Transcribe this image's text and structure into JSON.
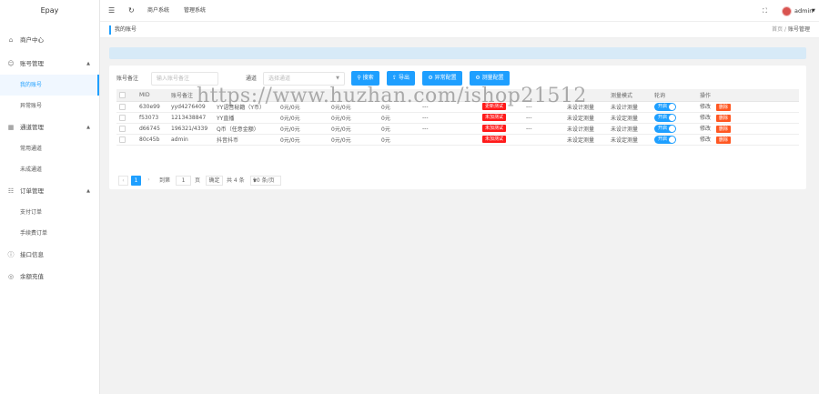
{
  "app": {
    "brand": "Epay"
  },
  "topbar": {
    "links": [
      "商户系统",
      "管理系统"
    ],
    "user": "admin"
  },
  "sidebar": {
    "items": [
      {
        "label": "商户中心",
        "icon": "home-icon"
      },
      {
        "label": "账号管理",
        "icon": "user-icon",
        "expanded": true,
        "children": [
          "我的账号",
          "异常账号"
        ]
      },
      {
        "label": "通道管理",
        "icon": "grid-icon",
        "expanded": true,
        "children": [
          "常用通道",
          "未成通道"
        ]
      },
      {
        "label": "订单管理",
        "icon": "order-icon",
        "expanded": true,
        "children": [
          "支付订单",
          "手续费订单"
        ]
      },
      {
        "label": "接口信息",
        "icon": "info-icon"
      },
      {
        "label": "余额充值",
        "icon": "wallet-icon"
      }
    ],
    "active": "我的账号"
  },
  "tabs": {
    "current": "我的账号"
  },
  "breadcrumb": {
    "home": "首页",
    "separator": "/",
    "current": "账号管理"
  },
  "filters": {
    "account_label": "账号备注",
    "account_placeholder": "输入账号备注",
    "channel_label": "通道",
    "channel_placeholder": "选择通道"
  },
  "buttons": {
    "search": "搜索",
    "export": "导出",
    "async_config": "异常配置",
    "batch_config": "测量配置"
  },
  "table": {
    "headers": [
      "",
      "MID",
      "账号备注",
      "",
      "",
      "",
      "",
      "",
      "",
      "",
      "",
      "测量模式",
      "轮询",
      "操作"
    ],
    "rows": [
      {
        "mid": "630e99",
        "account": "yyd4276409",
        "channel": "YY语音秘籍（Y币）",
        "m1": "0元/0元",
        "m2": "0元/0元",
        "m3": "0元",
        "m4": "---",
        "status": "更新测试",
        "m5": "---",
        "mode1": "未设计测量",
        "mode2": "未设计测量",
        "poll": "开启",
        "edit": "修改",
        "del": "删除"
      },
      {
        "mid": "f53073",
        "account": "1213438847",
        "channel": "YY直播",
        "m1": "0元/0元",
        "m2": "0元/0元",
        "m3": "0元",
        "m4": "---",
        "status": "未加测试",
        "m5": "---",
        "mode1": "未设定测量",
        "mode2": "未设定测量",
        "poll": "开启",
        "edit": "修改",
        "del": "删除"
      },
      {
        "mid": "d66745",
        "account": "196321/4339",
        "channel": "Q币（任意金额）",
        "m1": "0元/0元",
        "m2": "0元/0元",
        "m3": "0元",
        "m4": "---",
        "status": "未加测试",
        "m5": "---",
        "mode1": "未设计测量",
        "mode2": "未设计测量",
        "poll": "开启",
        "edit": "修改",
        "del": "删除"
      },
      {
        "mid": "80c45b",
        "account": "admin",
        "channel": "抖音抖币",
        "m1": "0元/0元",
        "m2": "0元/0元",
        "m3": "0元",
        "m4": "",
        "status": "未加测试",
        "m5": "",
        "mode1": "未设定测量",
        "mode2": "未设定测量",
        "poll": "开启",
        "edit": "修改",
        "del": "删除"
      }
    ]
  },
  "pager": {
    "prev": "‹",
    "current": "1",
    "next": "›",
    "goto_label": "到第",
    "goto_value": "1",
    "page_unit": "页",
    "confirm": "确定",
    "total": "共 4 条",
    "page_size": "10 条/页"
  },
  "watermark": "https://www.huzhan.com/ishop21512",
  "colors": {
    "accent": "#1e9fff",
    "danger": "#ff1a1a",
    "delete": "#ff5722"
  }
}
